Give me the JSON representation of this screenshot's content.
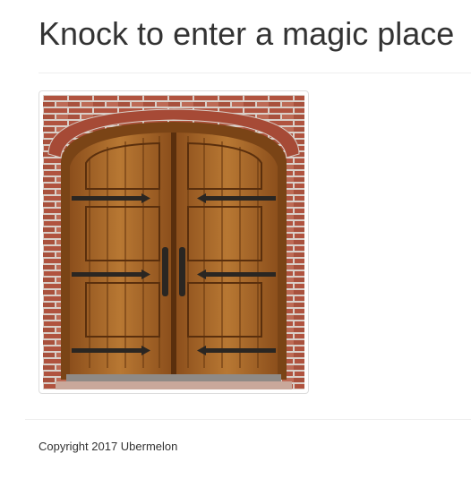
{
  "page": {
    "title": "Knock to enter a magic place"
  },
  "door_image": {
    "icon": "door-image",
    "colors": {
      "brick": "#b0533f",
      "mortar": "#d9cfc8",
      "wood": "#a8662a",
      "wood_dark": "#6e3d13",
      "iron": "#2a2622",
      "threshold": "#8f8a86"
    }
  },
  "footer": {
    "copyright": "Copyright 2017 Ubermelon"
  }
}
